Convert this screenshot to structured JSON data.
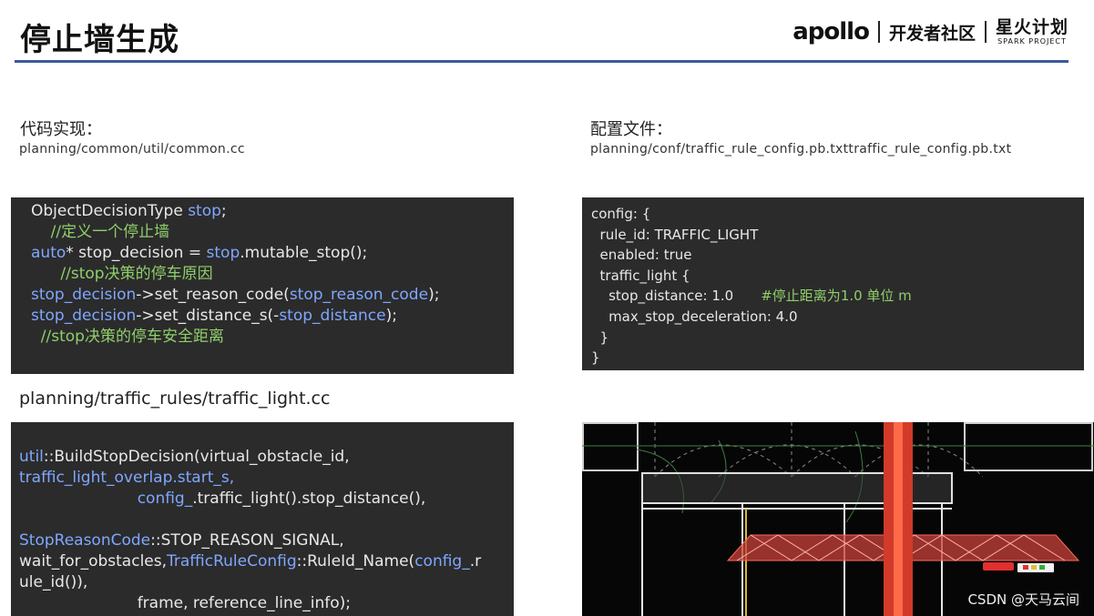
{
  "header": {
    "title": "停止墙生成",
    "brand_apollo": "apollo",
    "brand_community": "开发者社区",
    "brand_spark_cn": "星火计划",
    "brand_spark_en": "SPARK PROJECT"
  },
  "left": {
    "label": "代码实现：",
    "path": "planning/common/util/common.cc",
    "code1": [
      {
        "a": "ObjectDecisionType ",
        "b": "stop",
        "c": ";"
      },
      {
        "comment": "    //定义一个停止墙"
      },
      {
        "a": "auto",
        "b": "* stop_decision = ",
        "c": "stop",
        "d": ".mutable_stop();"
      },
      {
        "comment": "      //stop决策的停车原因"
      },
      {
        "a": "stop_decision",
        "b": "->set_reason_code(",
        "c": "stop_reason_code",
        "d": ");"
      },
      {
        "a": "stop_decision",
        "b": "->set_distance_s(-",
        "c": "stop_distance",
        "d": ");"
      },
      {
        "comment": "  //stop决策的停车安全距离"
      }
    ],
    "path2": "planning/traffic_rules/traffic_light.cc",
    "code2": {
      "l1a": "util",
      "l1b": "::BuildStopDecision(virtual_obstacle_id,",
      "l2": "traffic_light_overlap.start_s,",
      "l3a": "                        config_",
      "l3b": ".traffic_light().stop_distance(),",
      "l4a": "StopReasonCode",
      "l4b": "::STOP_REASON_SIGNAL,",
      "l5a": "wait_for_obstacles,",
      "l5b": "TrafficRuleConfig",
      "l5c": "::RuleId_Name(",
      "l5d": "config_",
      "l5e": ".r",
      "l6": "ule_id()),",
      "l7": "                        frame, reference_line_info);"
    }
  },
  "right": {
    "label": "配置文件：",
    "path": "planning/conf/traffic_rule_config.pb.txttraffic_rule_config.pb.txt",
    "config": [
      "config: {",
      "  rule_id: TRAFFIC_LIGHT",
      "  enabled: true",
      "  traffic_light {",
      "    stop_distance: 1.0",
      "    max_stop_deceleration: 4.0",
      "  }",
      "}"
    ],
    "config_comment": "#停止距离为1.0 单位 m"
  },
  "watermark": "CSDN @天马云间"
}
